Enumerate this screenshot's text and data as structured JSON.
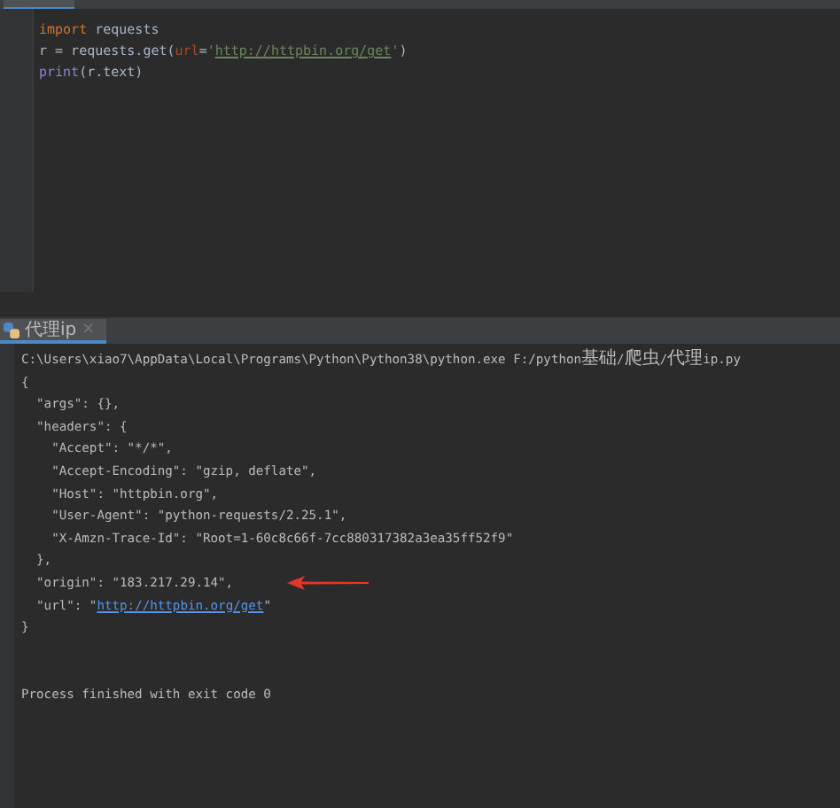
{
  "editor": {
    "lines": [
      [
        {
          "kind": "keyword",
          "text": "import"
        },
        {
          "kind": "plain",
          "text": " requests"
        }
      ],
      [
        {
          "kind": "plain",
          "text": "r = requests.get("
        },
        {
          "kind": "param",
          "text": "url"
        },
        {
          "kind": "plain",
          "text": "="
        },
        {
          "kind": "string",
          "text": "'"
        },
        {
          "kind": "link-string",
          "text": "http://httpbin.org/get"
        },
        {
          "kind": "string",
          "text": "'"
        },
        {
          "kind": "plain",
          "text": ")"
        }
      ],
      [
        {
          "kind": "builtin",
          "text": "print"
        },
        {
          "kind": "plain",
          "text": "(r.text)"
        }
      ]
    ]
  },
  "run_tab": {
    "label": "代理ip",
    "close": "×"
  },
  "console": {
    "lines": [
      {
        "kind": "command",
        "parts": [
          {
            "kind": "text",
            "text": "C:\\Users\\xiao7\\AppData\\Local\\Programs\\Python\\Python38\\python.exe F:/python基础/爬虫/代理ip.py"
          }
        ]
      },
      {
        "kind": "output",
        "parts": [
          {
            "kind": "text",
            "text": "{"
          }
        ]
      },
      {
        "kind": "output",
        "parts": [
          {
            "kind": "text",
            "text": "  \"args\": {},"
          }
        ]
      },
      {
        "kind": "output",
        "parts": [
          {
            "kind": "text",
            "text": "  \"headers\": {"
          }
        ]
      },
      {
        "kind": "output",
        "parts": [
          {
            "kind": "text",
            "text": "    \"Accept\": \"*/*\","
          }
        ]
      },
      {
        "kind": "output",
        "parts": [
          {
            "kind": "text",
            "text": "    \"Accept-Encoding\": \"gzip, deflate\","
          }
        ]
      },
      {
        "kind": "output",
        "parts": [
          {
            "kind": "text",
            "text": "    \"Host\": \"httpbin.org\","
          }
        ]
      },
      {
        "kind": "output",
        "parts": [
          {
            "kind": "text",
            "text": "    \"User-Agent\": \"python-requests/2.25.1\","
          }
        ]
      },
      {
        "kind": "output",
        "parts": [
          {
            "kind": "text",
            "text": "    \"X-Amzn-Trace-Id\": \"Root=1-60c8c66f-7cc880317382a3ea35ff52f9\""
          }
        ]
      },
      {
        "kind": "output",
        "parts": [
          {
            "kind": "text",
            "text": "  },"
          }
        ]
      },
      {
        "kind": "marked",
        "parts": [
          {
            "kind": "text",
            "text": "  \"origin\": \"183.217.29.14\","
          }
        ]
      },
      {
        "kind": "output",
        "parts": [
          {
            "kind": "text",
            "text": "  \"url\": \""
          },
          {
            "kind": "link",
            "text": "http://httpbin.org/get"
          },
          {
            "kind": "text",
            "text": "\""
          }
        ]
      },
      {
        "kind": "output",
        "parts": [
          {
            "kind": "text",
            "text": "}"
          }
        ]
      },
      {
        "kind": "exit",
        "parts": [
          {
            "kind": "text",
            "text": "Process finished with exit code 0"
          }
        ]
      }
    ]
  }
}
